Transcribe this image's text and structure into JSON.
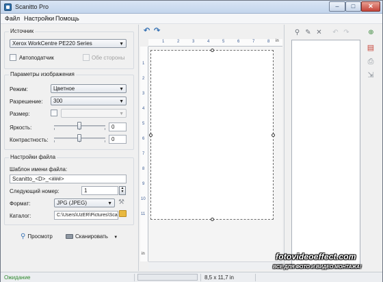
{
  "window": {
    "title": "Scanitto Pro"
  },
  "menu": {
    "items": [
      "Файл",
      "Настройки",
      "Помощь"
    ]
  },
  "source": {
    "title": "Источник",
    "scanner_value": "Xerox WorkCentre PE220 Series",
    "adf_label": "Автоподатчик",
    "duplex_label": "Обе стороны"
  },
  "image_params": {
    "title": "Параметры изображения",
    "mode_label": "Режим:",
    "mode_value": "Цветное",
    "resolution_label": "Разрешение:",
    "resolution_value": "300",
    "size_label": "Размер:",
    "size_value": "",
    "brightness_label": "Яркость:",
    "brightness_value": "0",
    "contrast_label": "Контрастность:",
    "contrast_value": "0"
  },
  "file_settings": {
    "title": "Настройки файла",
    "template_label": "Шаблон имени файла:",
    "template_value": "Scanitto_<D>_<###>",
    "next_number_label": "Следующий номер:",
    "next_number_value": "1",
    "format_label": "Формат:",
    "format_value": "JPG (JPEG)",
    "folder_label": "Каталог:",
    "folder_value": "C:\\Users\\UzER\\Pictures\\Scanitto"
  },
  "actions": {
    "preview_label": "Просмотр",
    "scan_label": "Сканировать"
  },
  "preview": {
    "unit": "in",
    "top_ruler_labels": [
      "1",
      "2",
      "3",
      "4",
      "5",
      "6",
      "7",
      "8"
    ],
    "left_ruler_labels": [
      "1",
      "2",
      "3",
      "4",
      "5",
      "6",
      "7",
      "8",
      "9",
      "10",
      "11"
    ]
  },
  "status": {
    "text": "Ожидание",
    "page_size": "8,5 x 11,7 in"
  },
  "watermark": {
    "line1": "fotovideoeffect.com",
    "line2": "ВСЕ ДЛЯ ФОТО И ВИДЕО МОНТАЖА!"
  },
  "colors": {
    "accent": "#3a74b5",
    "status_green": "#2f8a2f",
    "ruler_text": "#3b5c94"
  }
}
